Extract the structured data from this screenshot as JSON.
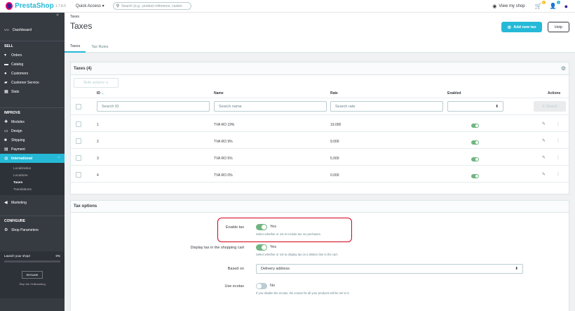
{
  "header": {
    "logo": "PrestaShop",
    "version": "1.7.8.5",
    "quick_access": "Quick Access ▾",
    "search_placeholder": "Search (e.g.: product reference, custon",
    "view_shop": "View my shop",
    "orders_badge": "1",
    "customers_badge": "1"
  },
  "sidebar": {
    "dashboard": "Dashboard",
    "sell": "SELL",
    "sell_items": [
      "Orders",
      "Catalog",
      "Customers",
      "Customer Service",
      "Stats"
    ],
    "improve": "IMPROVE",
    "improve_items": [
      "Modules",
      "Design",
      "Shipping",
      "Payment"
    ],
    "international": "International",
    "international_sub": [
      "Localization",
      "Locations",
      "Taxes",
      "Translations"
    ],
    "marketing": "Marketing",
    "configure": "CONFIGURE",
    "shop_parameters": "Shop Parameters",
    "launch_text": "Launch your shop!",
    "launch_pct": "0%",
    "resume": "RESUME",
    "stop": "Stop the OnBoarding"
  },
  "page": {
    "breadcrumb": "Taxes",
    "title": "Taxes",
    "add_button": "Add new tax",
    "help_button": "Help",
    "tabs": [
      "Taxes",
      "Tax Rules"
    ]
  },
  "taxes_panel": {
    "title": "Taxes (4)",
    "bulk_actions": "Bulk actions  ∨",
    "columns": [
      "ID",
      "Name",
      "Rate",
      "Enabled",
      "Actions"
    ],
    "filters": {
      "id_placeholder": "Search ID",
      "name_placeholder": "Search name",
      "rate_placeholder": "Search rate",
      "search_button": "Search"
    },
    "rows": [
      {
        "id": "1",
        "name": "TVA RO 19%",
        "rate": "19.000"
      },
      {
        "id": "2",
        "name": "TVA RO 9%",
        "rate": "9.000"
      },
      {
        "id": "3",
        "name": "TVA RO 5%",
        "rate": "5.000"
      },
      {
        "id": "4",
        "name": "TVA RO 0%",
        "rate": "0.000"
      }
    ]
  },
  "tax_options": {
    "title": "Tax options",
    "enable_tax": {
      "label": "Enable tax",
      "state": "Yes",
      "help": "Select whether or not to include tax on purchases."
    },
    "display_tax": {
      "label": "Display tax in the shopping cart",
      "state": "Yes",
      "help": "Select whether or not to display tax on a distinct line in the cart."
    },
    "based_on": {
      "label": "Based on",
      "value": "Delivery address"
    },
    "ecotax": {
      "label": "Use ecotax",
      "state": "No",
      "help": "If you disable the ecotax, the ecotax for all your products will be set to 0."
    }
  },
  "colors": {
    "accent": "#25b9d7",
    "sidebar": "#363a41",
    "toggle_on": "#70b580",
    "highlight": "#d0021b"
  }
}
